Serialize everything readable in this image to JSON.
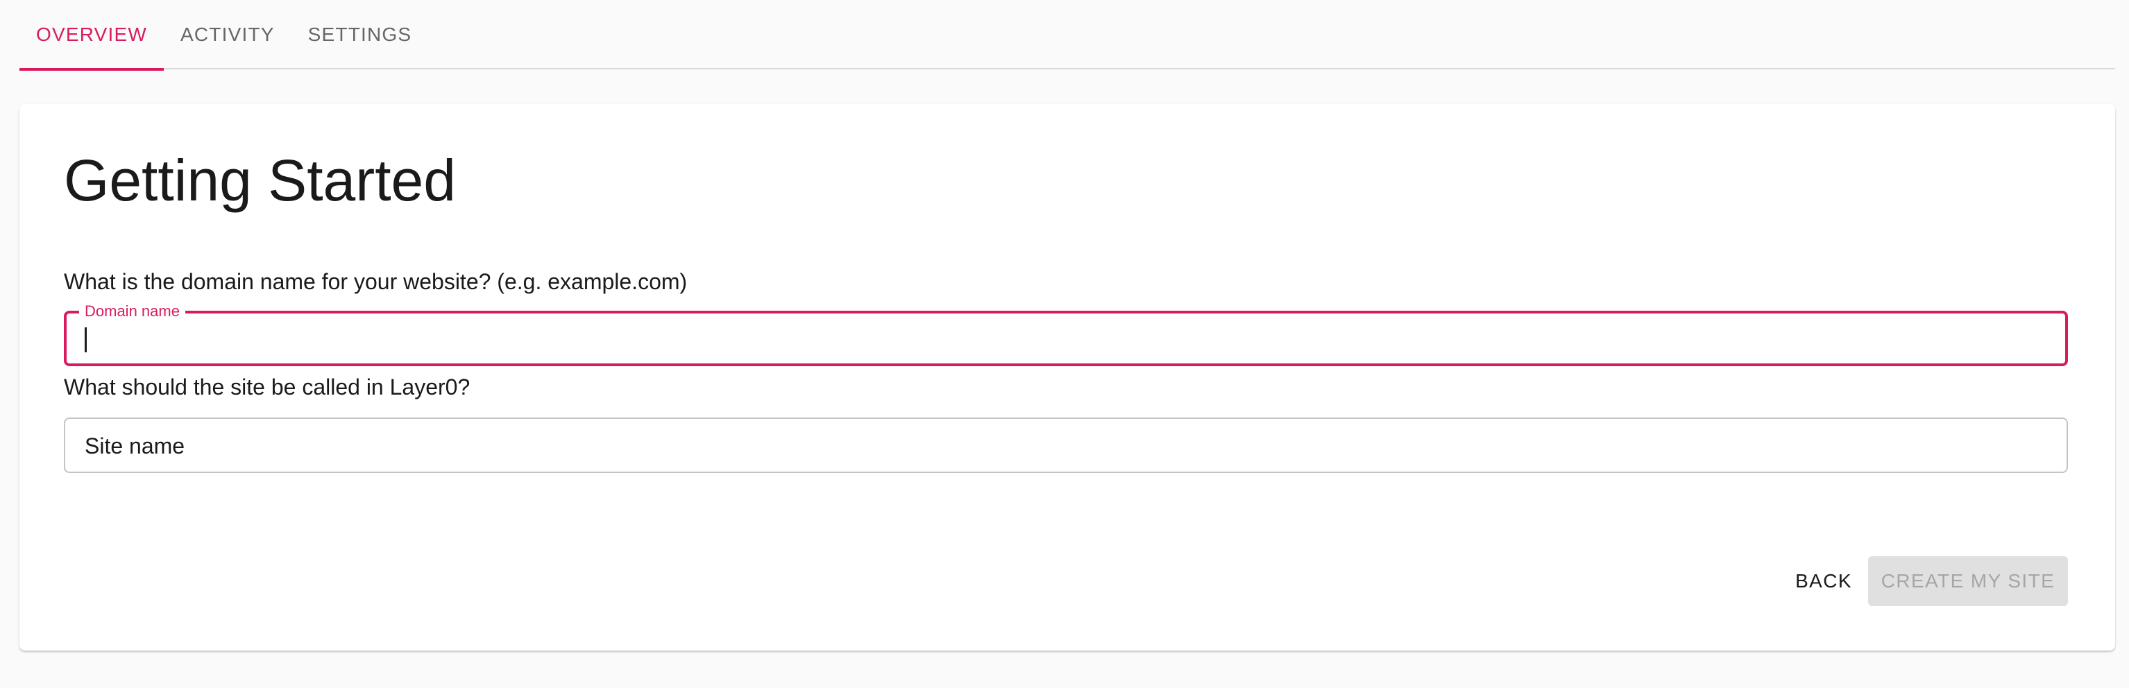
{
  "tabs": [
    {
      "label": "OVERVIEW",
      "active": true
    },
    {
      "label": "ACTIVITY",
      "active": false
    },
    {
      "label": "SETTINGS",
      "active": false
    }
  ],
  "card": {
    "title": "Getting Started",
    "domain_question": "What is the domain name for your website? (e.g. example.com)",
    "domain_field": {
      "label": "Domain name",
      "value": ""
    },
    "site_question": "What should the site be called in Layer0?",
    "site_field": {
      "placeholder": "Site name",
      "value": ""
    },
    "back_label": "BACK",
    "create_label": "CREATE MY SITE",
    "create_disabled": true
  },
  "colors": {
    "accent": "#d81b60",
    "disabled_bg": "#e0e0e0",
    "disabled_text": "#a6a6a6"
  }
}
